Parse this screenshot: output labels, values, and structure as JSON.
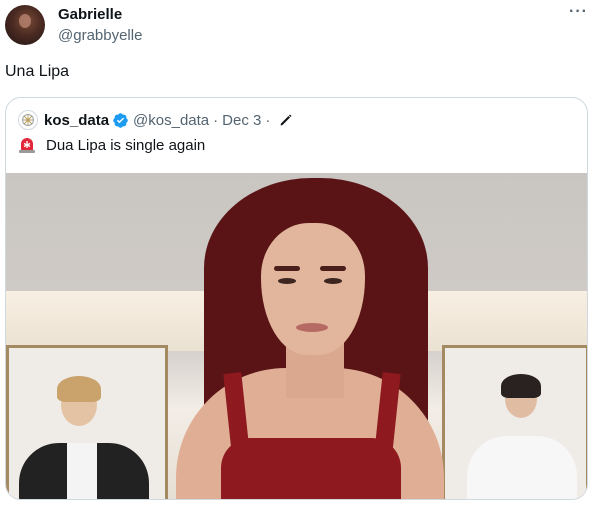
{
  "tweet": {
    "author_name": "Gabrielle",
    "author_handle": "@grabbyelle",
    "text": "Una Lipa",
    "more_icon": "more-horizontal-icon"
  },
  "quoted_tweet": {
    "author_name": "kos_data",
    "author_handle": "@kos_data",
    "separator": "·",
    "date": "Dec 3",
    "text": "Dua Lipa is single again",
    "verified_color": "#1d9bf0",
    "icons": [
      "verified-badge-icon",
      "edited-pencil-icon",
      "rotating-light-icon"
    ],
    "media": "photo"
  },
  "colors": {
    "text_primary": "#0f1419",
    "text_secondary": "#536471",
    "border": "#cfd9de",
    "dress": "#8e1a1f",
    "hair": "#5a1416"
  }
}
